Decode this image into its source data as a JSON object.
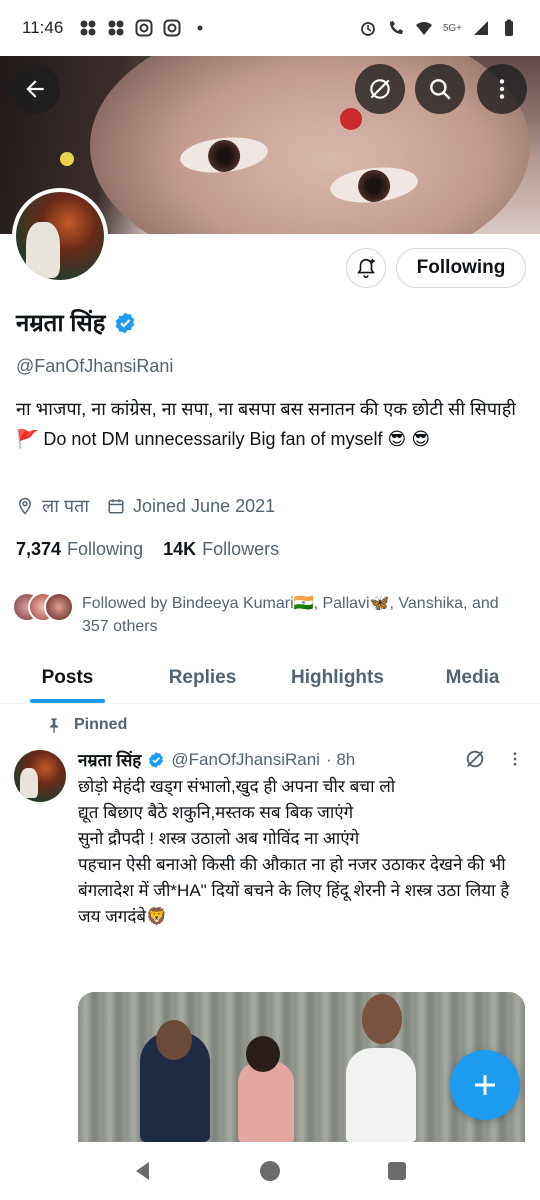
{
  "status_bar": {
    "time": "11:46",
    "network_label": "5G+",
    "icons": [
      "app-icon",
      "app-icon",
      "instagram-icon",
      "instagram-icon",
      "dot-icon",
      "alarm-icon",
      "wifi-call-icon",
      "wifi-icon",
      "signal-icon",
      "battery-icon"
    ]
  },
  "header": {
    "back_icon": "arrow-left-icon",
    "grok_icon": "grok-icon",
    "search_icon": "search-icon",
    "more_icon": "more-vertical-icon"
  },
  "profile": {
    "name": "नम्रता सिंह",
    "handle": "@FanOfJhansiRani",
    "bio": "ना भाजपा, ना कांग्रेस, ना सपा, ना बसपा बस सनातन की एक छोटी सी सिपाही 🚩 Do not DM unnecessarily  Big fan of myself 😎 😎",
    "location": "ला पता",
    "joined": "Joined June 2021",
    "following_count": "7,374",
    "following_label": "Following",
    "followers_count": "14K",
    "followers_label": "Followers",
    "followed_by": "Followed by Bindeeya Kumari🇮🇳, Pallavi🦋, Vanshika, and 357 others",
    "follow_button_label": "Following",
    "verified_color": "#1d9bf0"
  },
  "tabs": [
    {
      "label": "Posts",
      "active": true
    },
    {
      "label": "Replies",
      "active": false
    },
    {
      "label": "Highlights",
      "active": false
    },
    {
      "label": "Media",
      "active": false
    }
  ],
  "post": {
    "pinned_label": "Pinned",
    "author_name": "नम्रता सिंह",
    "author_handle": "@FanOfJhansiRani",
    "time": "· 8h",
    "text_lines": [
      "छोड़ो मेहंदी खड्ग संभालो,खुद ही अपना चीर बचा लो",
      "द्यूत बिछाए बैठे शकुनि,मस्तक सब बिक जाएंगे",
      "सुनो द्रौपदी ! शस्त्र उठालो अब गोविंद ना आएंगे",
      "पहचान ऐसी बनाओ किसी की औकात ना हो नजर उठाकर देखने की भी",
      "बंगलादेश में जी*HA\" दियों बचने के लिए हिंदू शेरनी ने शस्त्र उठा लिया है",
      "जय जगदंबे🦁"
    ]
  },
  "colors": {
    "accent": "#1d9bf0",
    "text_primary": "#0f1419",
    "text_secondary": "#536471"
  }
}
